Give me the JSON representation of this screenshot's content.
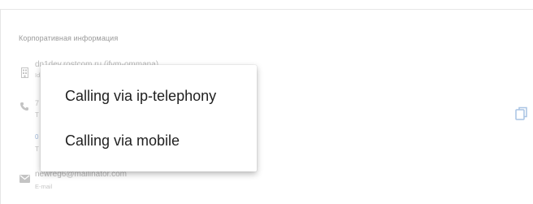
{
  "section": {
    "title": "Корпоративная информация"
  },
  "company": {
    "value": "dn1dev.rostcom.ru (ifvm-ommana)",
    "label": "Id"
  },
  "phone": {
    "value": "7",
    "label": "T"
  },
  "extra_row": {
    "value": "0",
    "label": "T"
  },
  "email": {
    "value": "newreg6@mailinator.com",
    "label": "E-mail"
  },
  "call_menu": {
    "items": [
      {
        "label": "Calling via ip-telephony"
      },
      {
        "label": "Calling via mobile"
      }
    ]
  },
  "icons": {
    "company": "building-icon",
    "phone": "phone-icon",
    "email": "mail-icon",
    "copy": "copy-icon"
  },
  "colors": {
    "icon_gray": "#c4c4c4",
    "copy_blue": "#a9c4e4",
    "menu_text": "#1f1f1f"
  }
}
